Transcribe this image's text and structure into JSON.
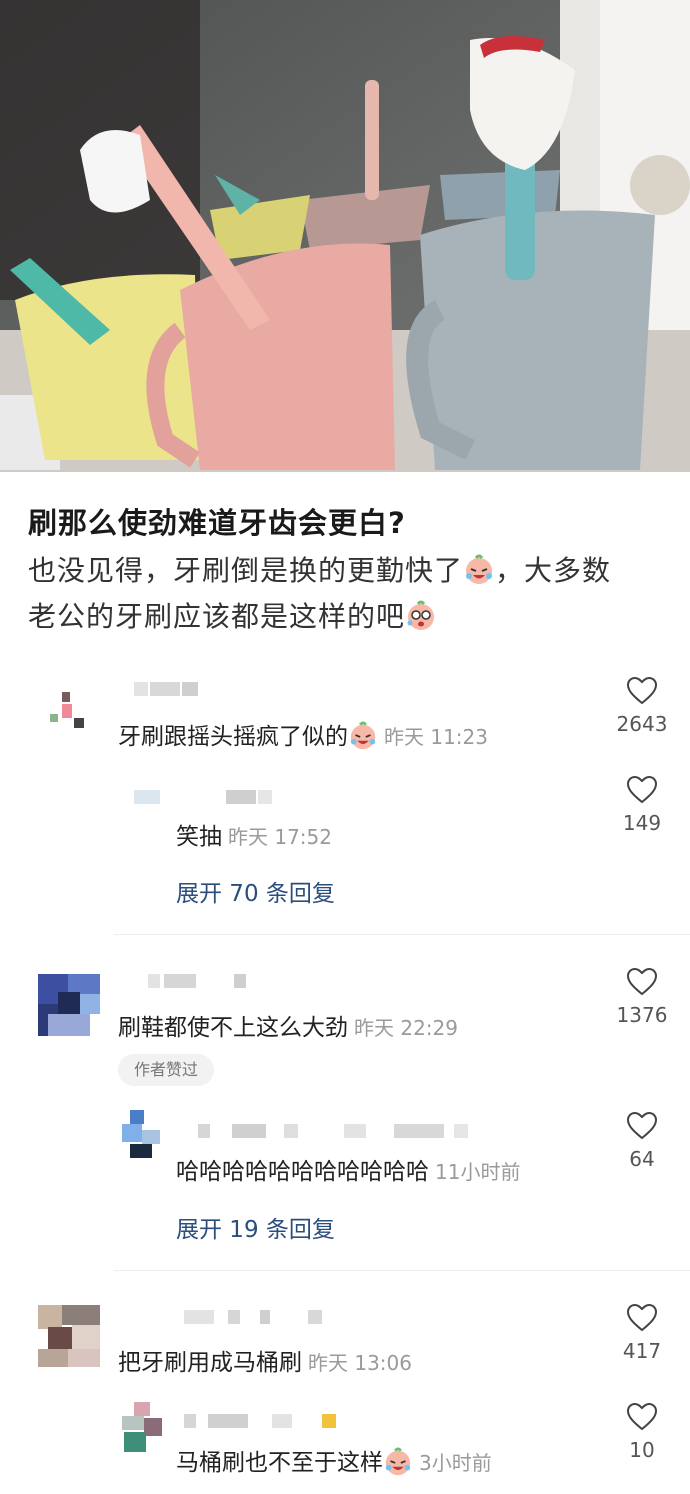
{
  "post": {
    "title": "刷那么使劲难道牙齿会更白?",
    "body_line1": "也没见得，牙刷倒是换的更勤快了",
    "body_line1_tail": "，大多数",
    "body_line2": "老公的牙刷应该都是这样的吧",
    "image_desc_icons": [
      "toothbrush-cups-photo"
    ]
  },
  "comments": [
    {
      "text": "牙刷跟摇头摇疯了似的",
      "time": "昨天 11:23",
      "likes": "2643",
      "replies": [
        {
          "text": "笑抽",
          "time": "昨天 17:52",
          "likes": "149"
        }
      ],
      "expand": "展开 70 条回复"
    },
    {
      "text": "刷鞋都使不上这么大劲",
      "time": "昨天 22:29",
      "likes": "1376",
      "badge": "作者赞过",
      "replies": [
        {
          "text": "哈哈哈哈哈哈哈哈哈哈哈",
          "time": "11小时前",
          "likes": "64"
        }
      ],
      "expand": "展开 19 条回复"
    },
    {
      "text": "把牙刷用成马桶刷",
      "time": "昨天 13:06",
      "likes": "417",
      "replies": [
        {
          "text": "马桶刷也不至于这样",
          "time": "3小时前",
          "likes": "10"
        }
      ]
    }
  ],
  "colors": {
    "link": "#2b4e7f",
    "meta": "#9a9a9a"
  }
}
